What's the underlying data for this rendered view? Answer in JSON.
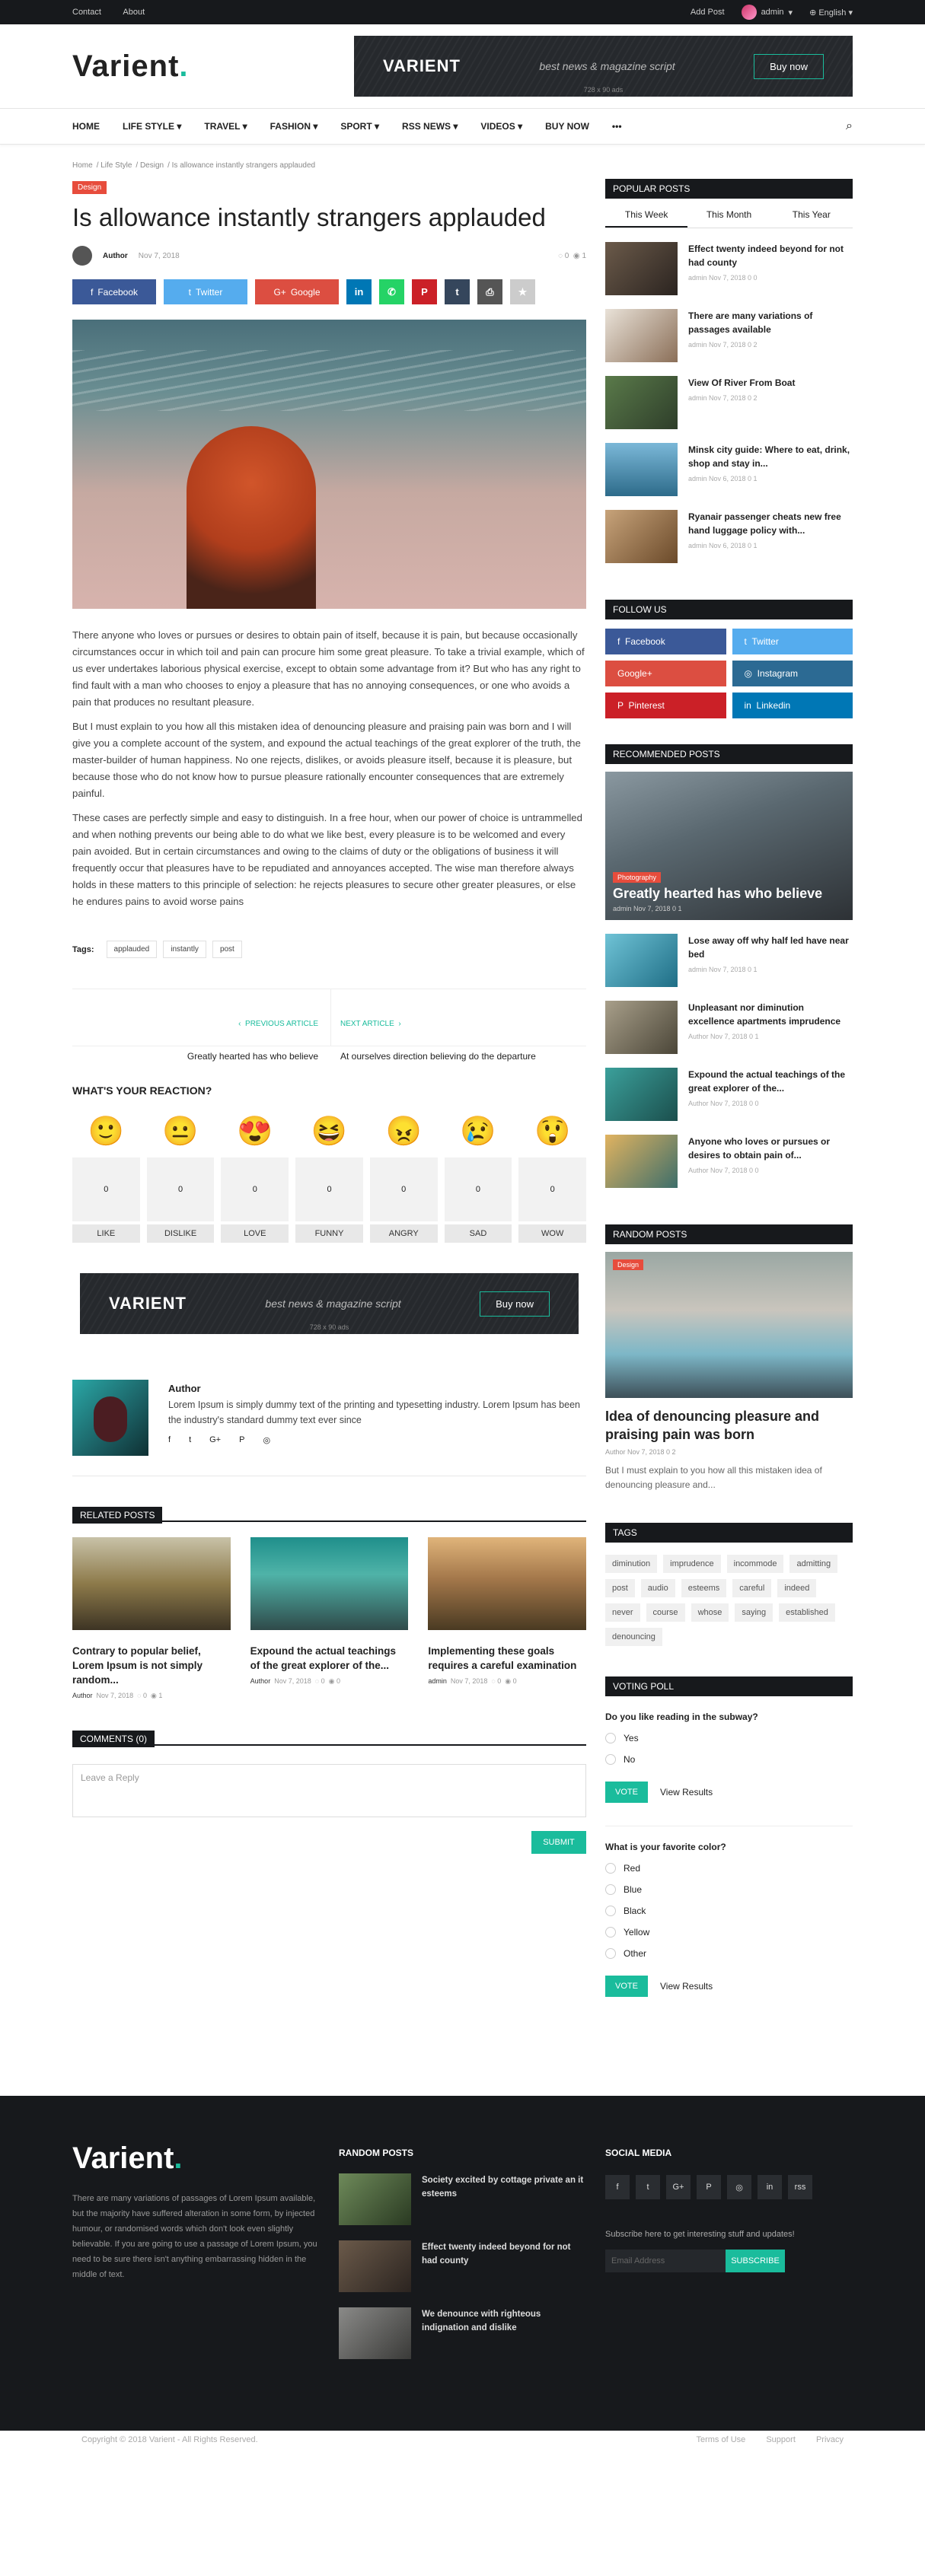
{
  "topbar": {
    "left": [
      "Contact",
      "About"
    ],
    "add_post": "Add Post",
    "user": "admin",
    "lang": "English"
  },
  "header": {
    "logo": "Varient",
    "ad": {
      "logo": "VARIENT",
      "tagline": "best news & magazine script",
      "button": "Buy now",
      "size": "728 x 90 ads"
    }
  },
  "nav": [
    "HOME",
    "LIFE STYLE",
    "TRAVEL",
    "FASHION",
    "SPORT",
    "RSS NEWS",
    "VIDEOS",
    "BUY NOW",
    "•••"
  ],
  "breadcrumb": [
    "Home",
    "Life Style",
    "Design",
    "Is allowance instantly strangers applauded"
  ],
  "article": {
    "category": "Design",
    "title": "Is allowance instantly strangers applauded",
    "author": "Author",
    "date": "Nov 7, 2018",
    "comments": "0",
    "views": "1",
    "paragraphs": [
      "There anyone who loves or pursues or desires to obtain pain of itself, because it is pain, but because occasionally circumstances occur in which toil and pain can procure him some great pleasure. To take a trivial example, which of us ever undertakes laborious physical exercise, except to obtain some advantage from it? But who has any right to find fault with a man who chooses to enjoy a pleasure that has no annoying consequences, or one who avoids a pain that produces no resultant pleasure.",
      "But I must explain to you how all this mistaken idea of denouncing pleasure and praising pain was born and I will give you a complete account of the system, and expound the actual teachings of the great explorer of the truth, the master-builder of human happiness. No one rejects, dislikes, or avoids pleasure itself, because it is pleasure, but because those who do not know how to pursue pleasure rationally encounter consequences that are extremely painful.",
      "These cases are perfectly simple and easy to distinguish. In a free hour, when our power of choice is untrammelled and when nothing prevents our being able to do what we like best, every pleasure is to be welcomed and every pain avoided. But in certain circumstances and owing to the claims of duty or the obligations of business it will frequently occur that pleasures have to be repudiated and annoyances accepted. The wise man therefore always holds in these matters to this principle of selection: he rejects pleasures to secure other greater pleasures, or else he endures pains to avoid worse pains"
    ],
    "tags_label": "Tags:",
    "tags": [
      "applauded",
      "instantly",
      "post"
    ]
  },
  "share": {
    "facebook": "Facebook",
    "twitter": "Twitter",
    "google": "Google"
  },
  "prevnext": {
    "prev_label": "PREVIOUS ARTICLE",
    "prev_title": "Greatly hearted has who believe",
    "next_label": "NEXT ARTICLE",
    "next_title": "At ourselves direction believing do the departure"
  },
  "reactions": {
    "heading": "WHAT'S YOUR REACTION?",
    "items": [
      {
        "emoji": "🙂",
        "count": "0",
        "label": "LIKE"
      },
      {
        "emoji": "😐",
        "count": "0",
        "label": "DISLIKE"
      },
      {
        "emoji": "😍",
        "count": "0",
        "label": "LOVE"
      },
      {
        "emoji": "😆",
        "count": "0",
        "label": "FUNNY"
      },
      {
        "emoji": "😠",
        "count": "0",
        "label": "ANGRY"
      },
      {
        "emoji": "😢",
        "count": "0",
        "label": "SAD"
      },
      {
        "emoji": "😲",
        "count": "0",
        "label": "WOW"
      }
    ]
  },
  "author_box": {
    "name": "Author",
    "desc": "Lorem Ipsum is simply dummy text of the printing and typesetting industry. Lorem Ipsum has been the industry's standard dummy text ever since",
    "icons": [
      "f",
      "t",
      "G+",
      "P",
      "◎"
    ]
  },
  "related": {
    "heading": "RELATED POSTS",
    "items": [
      {
        "title": "Contrary to popular belief, Lorem Ipsum is not simply random...",
        "author": "Author",
        "date": "Nov 7, 2018",
        "c": "0",
        "v": "1"
      },
      {
        "title": "Expound the actual teachings of the great explorer of the...",
        "author": "Author",
        "date": "Nov 7, 2018",
        "c": "0",
        "v": "0"
      },
      {
        "title": "Implementing these goals requires a careful examination",
        "author": "admin",
        "date": "Nov 7, 2018",
        "c": "0",
        "v": "0"
      }
    ]
  },
  "comments": {
    "heading": "COMMENTS (0)",
    "placeholder": "Leave a Reply",
    "submit": "SUBMIT"
  },
  "sidebar": {
    "popular": {
      "heading": "POPULAR POSTS",
      "tabs": [
        "This Week",
        "This Month",
        "This Year"
      ],
      "items": [
        {
          "title": "Effect twenty indeed beyond for not had county",
          "meta": "admin   Nov 7, 2018   0   0"
        },
        {
          "title": "There are many variations of passages available",
          "meta": "admin   Nov 7, 2018   0   2"
        },
        {
          "title": "View Of River From Boat",
          "meta": "admin   Nov 7, 2018   0   2"
        },
        {
          "title": "Minsk city guide: Where to eat, drink, shop and stay in...",
          "meta": "admin   Nov 6, 2018   0   1"
        },
        {
          "title": "Ryanair passenger cheats new free hand luggage policy with...",
          "meta": "admin   Nov 6, 2018   0   1"
        }
      ]
    },
    "follow": {
      "heading": "FOLLOW US",
      "items": [
        "Facebook",
        "Twitter",
        "Google+",
        "Instagram",
        "Pinterest",
        "Linkedin"
      ]
    },
    "recommended": {
      "heading": "RECOMMENDED POSTS",
      "hero_badge": "Photography",
      "hero_title": "Greatly hearted has who believe",
      "hero_meta": "admin   Nov 7, 2018   0   1",
      "items": [
        {
          "title": "Lose away off why half led have near bed",
          "meta": "admin   Nov 7, 2018   0   1"
        },
        {
          "title": "Unpleasant nor diminution excellence apartments imprudence",
          "meta": "Author   Nov 7, 2018   0   1"
        },
        {
          "title": "Expound the actual teachings of the great explorer of the...",
          "meta": "Author   Nov 7, 2018   0   0"
        },
        {
          "title": "Anyone who loves or pursues or desires to obtain pain of...",
          "meta": "Author   Nov 7, 2018   0   0"
        }
      ]
    },
    "random": {
      "heading": "RANDOM POSTS",
      "badge": "Design",
      "title": "Idea of denouncing pleasure and praising pain was born",
      "meta": "Author   Nov 7, 2018   0   2",
      "desc": "But I must explain to you how all this mistaken idea of denouncing pleasure and..."
    },
    "tags": {
      "heading": "TAGS",
      "items": [
        "diminution",
        "imprudence",
        "incommode",
        "admitting",
        "post",
        "audio",
        "esteems",
        "careful",
        "indeed",
        "never",
        "course",
        "whose",
        "saying",
        "established",
        "denouncing"
      ]
    },
    "poll": {
      "heading": "VOTING POLL",
      "q1": "Do you like reading in the subway?",
      "q1_opts": [
        "Yes",
        "No"
      ],
      "q2": "What is your favorite color?",
      "q2_opts": [
        "Red",
        "Blue",
        "Black",
        "Yellow",
        "Other"
      ],
      "vote": "VOTE",
      "results": "View Results"
    }
  },
  "footer": {
    "logo": "Varient",
    "desc": "There are many variations of passages of Lorem Ipsum available, but the majority have suffered alteration in some form, by injected humour, or randomised words which don't look even slightly believable. If you are going to use a passage of Lorem Ipsum, you need to be sure there isn't anything embarrassing hidden in the middle of text.",
    "random_heading": "RANDOM POSTS",
    "random": [
      "Society excited by cottage private an it esteems",
      "Effect twenty indeed beyond for not had county",
      "We denounce with righteous indignation and dislike"
    ],
    "social_heading": "SOCIAL MEDIA",
    "social": [
      "f",
      "t",
      "G+",
      "P",
      "◎",
      "in",
      "rss"
    ],
    "subscribe_text": "Subscribe here to get interesting stuff and updates!",
    "email_placeholder": "Email Address",
    "subscribe_btn": "SUBSCRIBE",
    "copyright": "Copyright © 2018 Varient - All Rights Reserved.",
    "links": [
      "Terms of Use",
      "Support",
      "Privacy"
    ]
  },
  "colors": {
    "accent": "#1abc9c",
    "dark": "#17191c",
    "red": "#e74c3c"
  }
}
